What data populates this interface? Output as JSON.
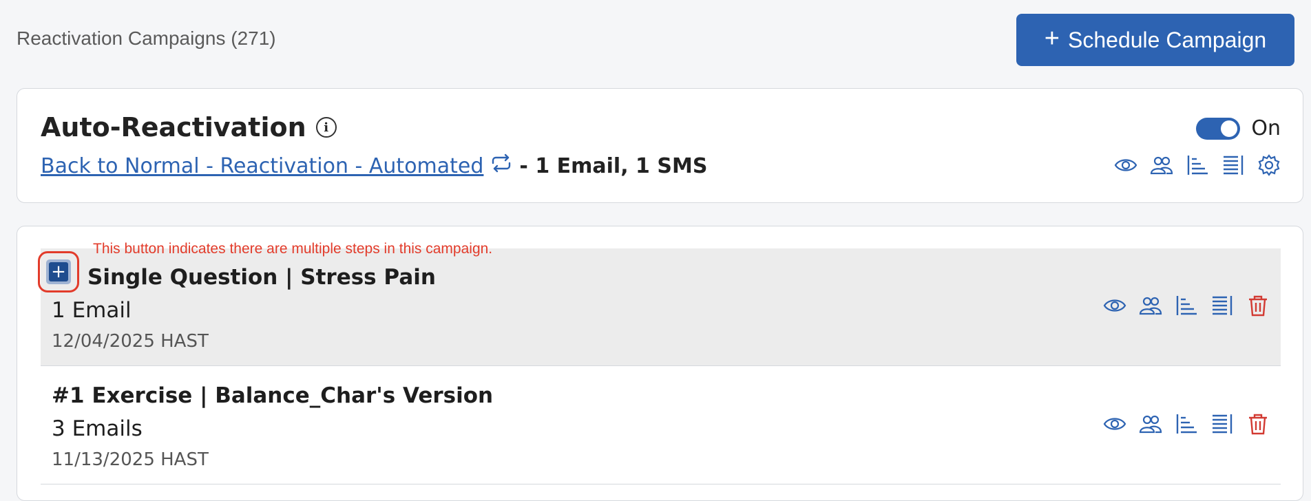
{
  "header": {
    "title": "Reactivation Campaigns (271)",
    "schedule_button_icon": "plus-icon",
    "schedule_button_label": "Schedule Campaign"
  },
  "auto_reactivation": {
    "title": "Auto-Reactivation",
    "info_icon": "info-icon",
    "campaign_link": "Back to Normal - Reactivation - Automated",
    "repeat_icon": "repeat-icon",
    "campaign_summary": "- 1 Email, 1 SMS",
    "toggle_state": true,
    "toggle_label": "On",
    "actions": [
      "eye-icon",
      "audience-icon",
      "steps-icon",
      "report-icon",
      "gear-icon"
    ]
  },
  "annotation": "This button indicates there are multiple steps in this campaign.",
  "campaigns": [
    {
      "title": "Single Question | Stress Pain",
      "count": "1 Email",
      "date": "12/04/2025 HAST",
      "expand_icon": "plus-icon",
      "actions": [
        "eye-icon",
        "audience-icon",
        "steps-icon",
        "report-icon",
        "trash-icon"
      ]
    },
    {
      "title": "#1 Exercise | Balance_Char's Version",
      "count": "3 Emails",
      "date": "11/13/2025 HAST",
      "actions": [
        "eye-icon",
        "audience-icon",
        "steps-icon",
        "report-icon",
        "trash-icon"
      ]
    }
  ],
  "colors": {
    "accent": "#2d63b2",
    "delete": "#d23a32",
    "annotation": "#e23b2a",
    "row_highlight": "#ececec"
  }
}
